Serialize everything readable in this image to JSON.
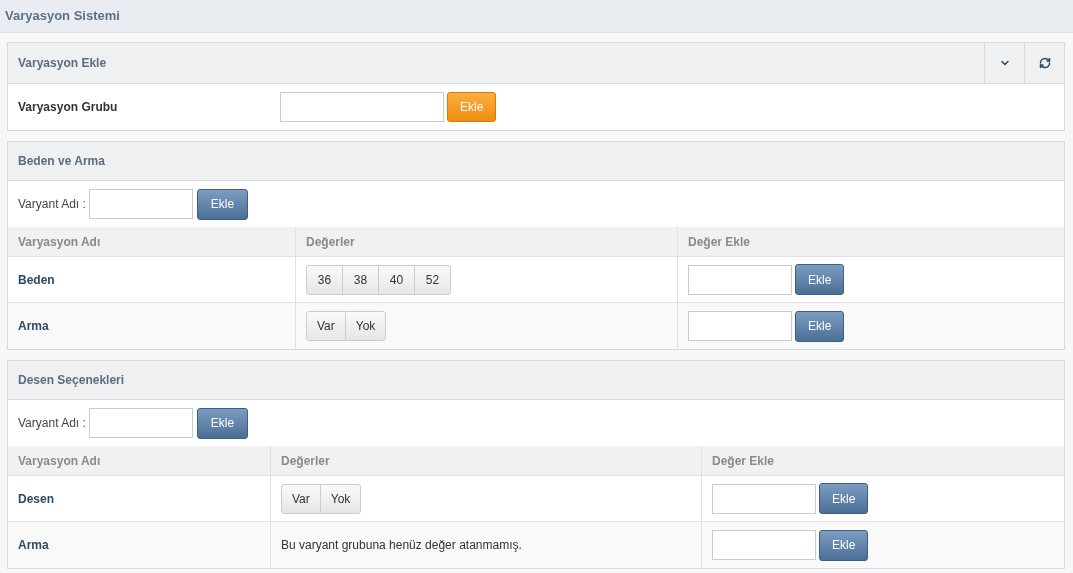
{
  "page_title": "Varyasyon Sistemi",
  "add_panel": {
    "title": "Varyasyon Ekle",
    "label": "Varyasyon Grubu",
    "button": "Ekle"
  },
  "groups": [
    {
      "title": "Beden ve Arma",
      "variant_label": "Varyant Adı :",
      "variant_button": "Ekle",
      "columns": [
        "Varyasyon Adı",
        "Değerler",
        "Değer Ekle"
      ],
      "rows": [
        {
          "name": "Beden",
          "kind": "values",
          "values": [
            "36",
            "38",
            "40",
            "52"
          ],
          "button": "Ekle"
        },
        {
          "name": "Arma",
          "kind": "values",
          "values": [
            "Var",
            "Yok"
          ],
          "button": "Ekle"
        }
      ]
    },
    {
      "title": "Desen Seçenekleri",
      "variant_label": "Varyant Adı :",
      "variant_button": "Ekle",
      "columns": [
        "Varyasyon Adı",
        "Değerler",
        "Değer Ekle"
      ],
      "rows": [
        {
          "name": "Desen",
          "kind": "values",
          "values": [
            "Var",
            "Yok"
          ],
          "button": "Ekle"
        },
        {
          "name": "Arma",
          "kind": "empty",
          "message": "Bu varyant grubuna henüz değer atanmamış.",
          "button": "Ekle"
        }
      ]
    }
  ]
}
